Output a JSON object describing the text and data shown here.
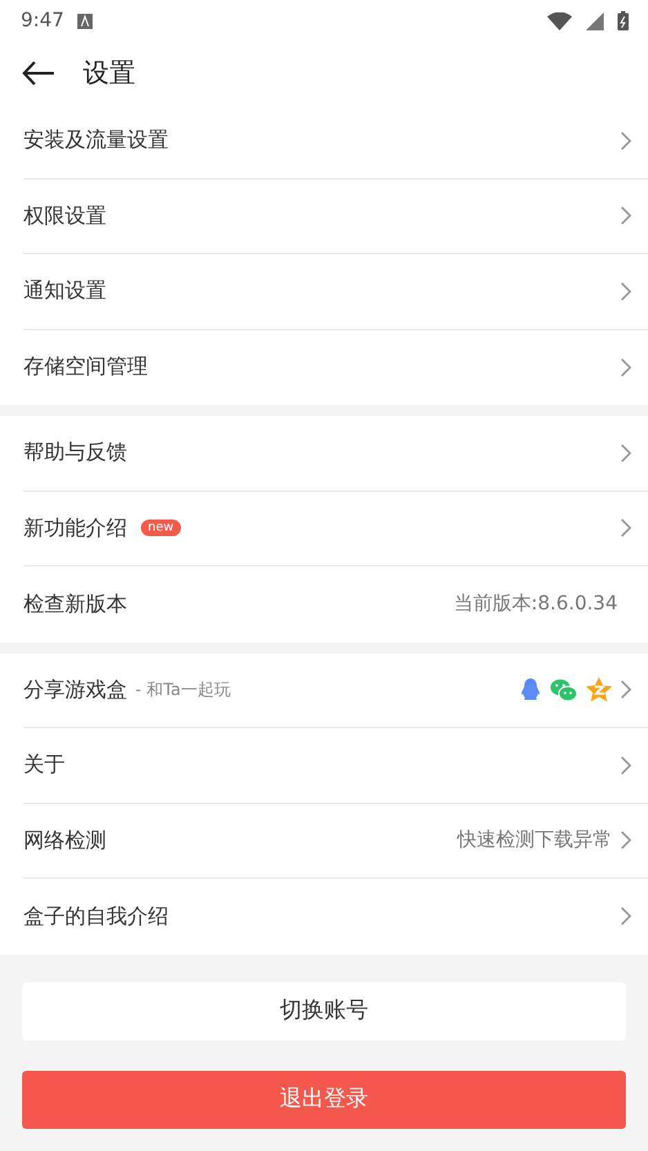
{
  "status_bar": {
    "time": "9:47"
  },
  "header": {
    "title": "设置"
  },
  "sections": [
    {
      "items": [
        {
          "kind": "link",
          "label": "安装及流量设置"
        },
        {
          "kind": "link",
          "label": "权限设置"
        },
        {
          "kind": "link",
          "label": "通知设置"
        },
        {
          "kind": "link",
          "label": "存储空间管理"
        }
      ]
    },
    {
      "items": [
        {
          "kind": "link",
          "label": "帮助与反馈"
        },
        {
          "kind": "link",
          "label": "新功能介绍",
          "badge": "new"
        },
        {
          "kind": "value",
          "label": "检查新版本",
          "value": "当前版本:8.6.0.34"
        }
      ]
    },
    {
      "items": [
        {
          "kind": "share",
          "label": "分享游戏盒",
          "suffix": "- 和Ta一起玩"
        },
        {
          "kind": "link",
          "label": "关于"
        },
        {
          "kind": "link",
          "label": "网络检测",
          "value": "快速检测下载异常"
        },
        {
          "kind": "link",
          "label": "盒子的自我介绍"
        }
      ]
    }
  ],
  "buttons": [
    {
      "kind": "secondary",
      "label": "切换账号"
    },
    {
      "kind": "danger",
      "label": "退出登录"
    }
  ]
}
